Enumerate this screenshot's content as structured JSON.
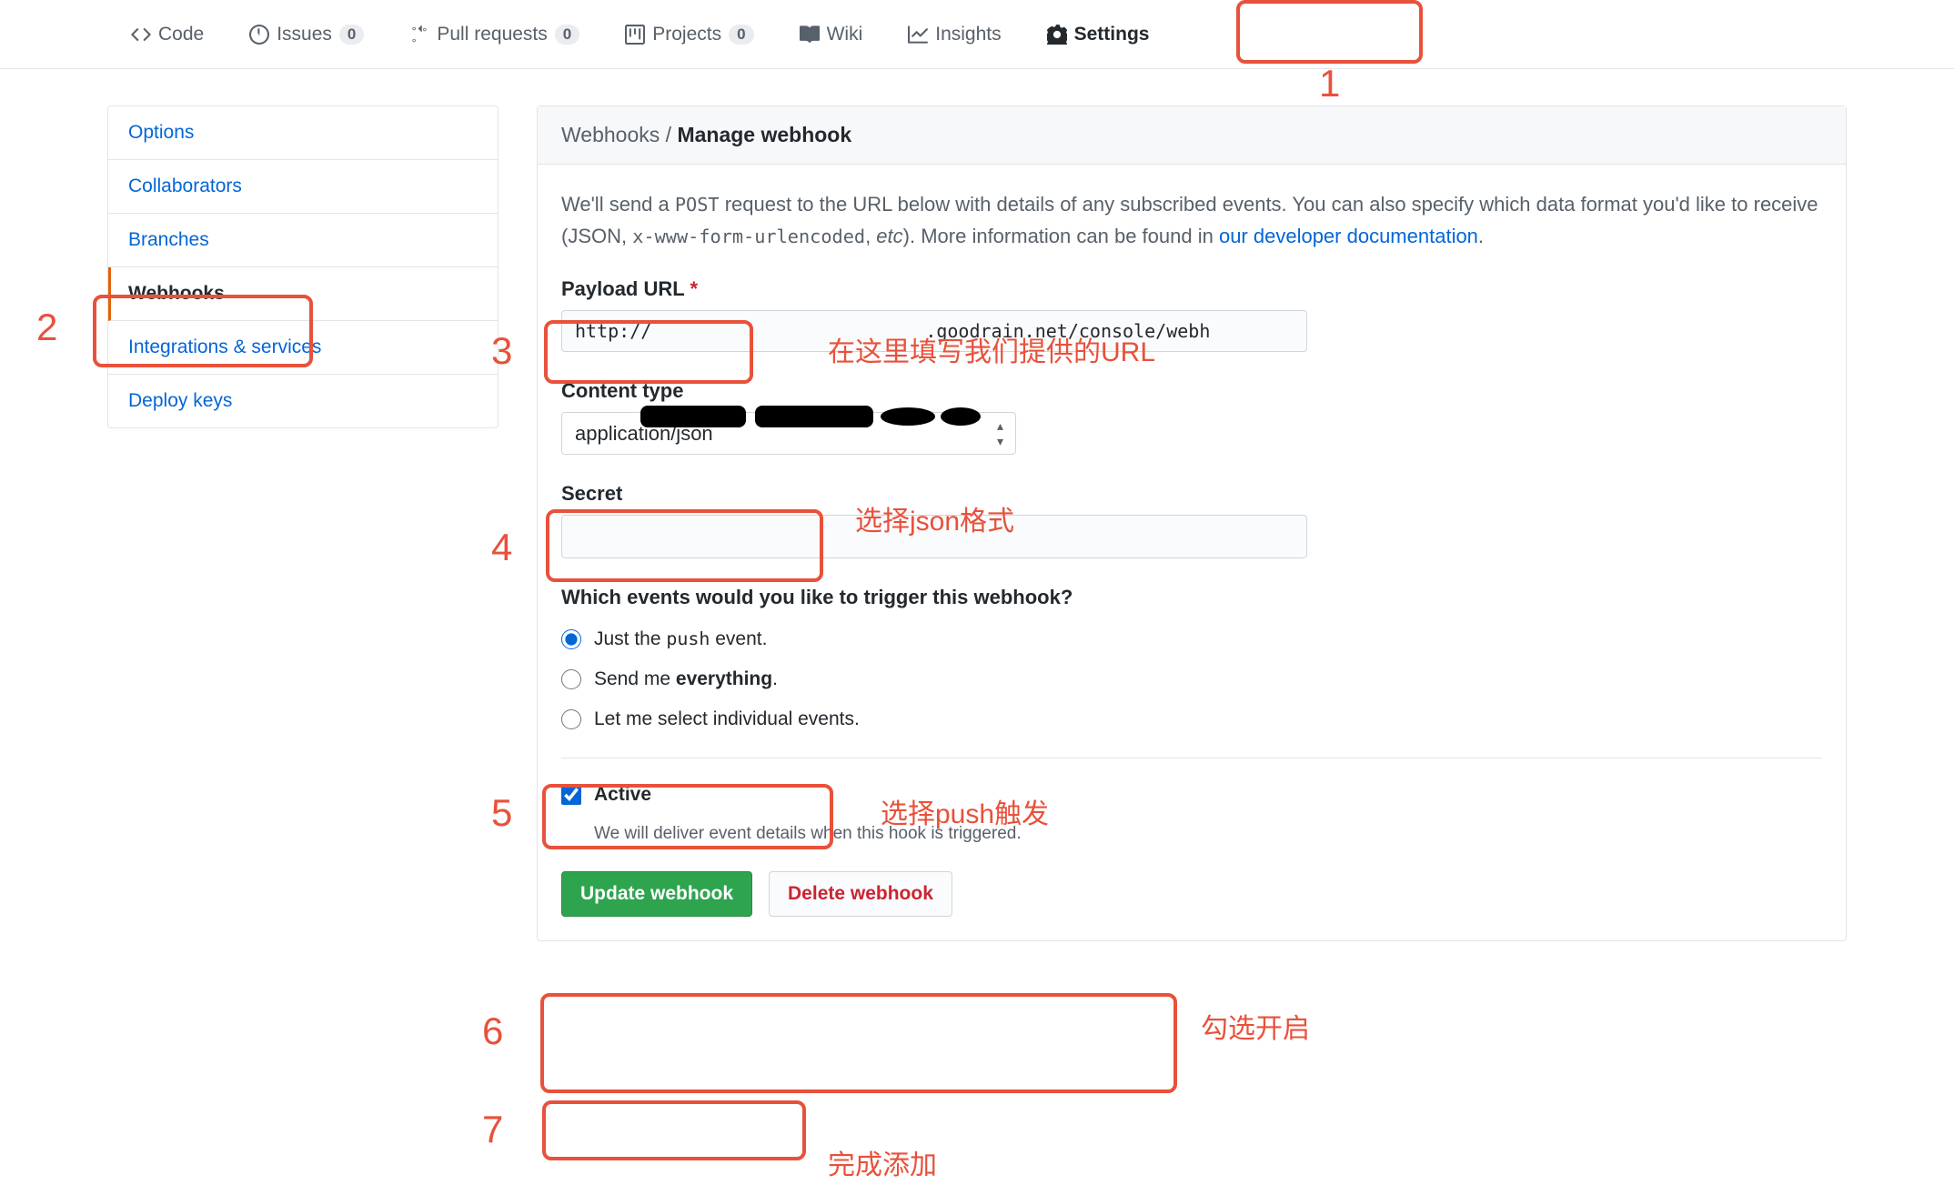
{
  "topnav": {
    "items": [
      {
        "label": "Code"
      },
      {
        "label": "Issues",
        "count": "0"
      },
      {
        "label": "Pull requests",
        "count": "0"
      },
      {
        "label": "Projects",
        "count": "0"
      },
      {
        "label": "Wiki"
      },
      {
        "label": "Insights"
      },
      {
        "label": "Settings"
      }
    ]
  },
  "sidebar": {
    "items": [
      {
        "label": "Options"
      },
      {
        "label": "Collaborators"
      },
      {
        "label": "Branches"
      },
      {
        "label": "Webhooks"
      },
      {
        "label": "Integrations & services"
      },
      {
        "label": "Deploy keys"
      }
    ]
  },
  "breadcrumb": {
    "parent": "Webhooks",
    "sep": " / ",
    "current": "Manage webhook"
  },
  "intro": {
    "p1a": "We'll send a ",
    "post": "POST",
    "p1b": " request to the URL below with details of any subscribed events. You can also specify which data format you'd like to receive (JSON, ",
    "enc": "x-www-form-urlencoded",
    "p1c": ", ",
    "etc": "etc",
    "p1d": "). More information can be found in ",
    "link": "our developer documentation",
    "p1e": "."
  },
  "form": {
    "payload_label": "Payload URL",
    "required": "*",
    "payload_value_prefix": "http://",
    "payload_value_suffix": ".goodrain.net/console/webh",
    "content_type_label": "Content type",
    "content_type_value": "application/json",
    "secret_label": "Secret",
    "secret_value": "",
    "events_label": "Which events would you like to trigger this webhook?",
    "event_opts": {
      "push_a": "Just the ",
      "push_code": "push",
      "push_b": " event.",
      "everything_a": "Send me ",
      "everything_b": "everything",
      "everything_c": ".",
      "individual": "Let me select individual events."
    },
    "active_label": "Active",
    "active_note": "We will deliver event details when this hook is triggered.",
    "update_btn": "Update webhook",
    "delete_btn": "Delete webhook"
  },
  "annotations": {
    "n1": "1",
    "n2": "2",
    "n3": "3",
    "n4": "4",
    "n5": "5",
    "n6": "6",
    "n7": "7",
    "t3": "在这里填写我们提供的URL",
    "t4": "选择json格式",
    "t5": "选择push触发",
    "t6": "勾选开启",
    "t7": "完成添加"
  }
}
